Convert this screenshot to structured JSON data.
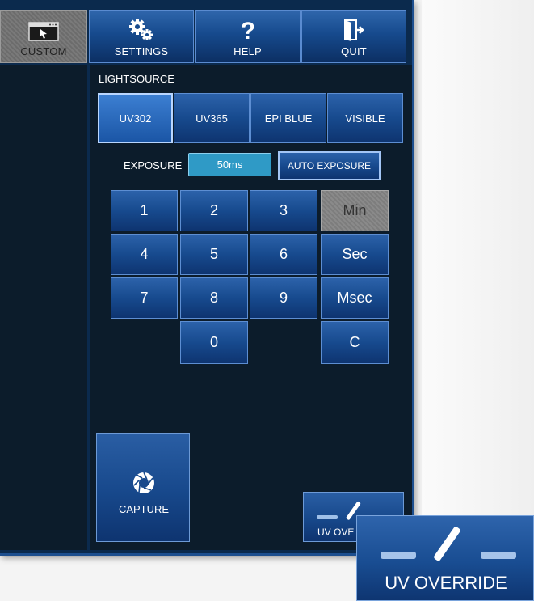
{
  "toolbar": {
    "custom_label": "CUSTOM",
    "settings_label": "SETTINGS",
    "help_label": "HELP",
    "quit_label": "QUIT"
  },
  "lightsource": {
    "label": "LIGHTSOURCE",
    "options": [
      "UV302",
      "UV365",
      "EPI BLUE",
      "VISIBLE"
    ],
    "selected": "UV302"
  },
  "exposure": {
    "label": "EXPOSURE",
    "value": "50ms",
    "auto_label": "AUTO EXPOSURE"
  },
  "keypad": {
    "digits": [
      "1",
      "2",
      "3",
      "4",
      "5",
      "6",
      "7",
      "8",
      "9",
      "0"
    ],
    "units": [
      "Min",
      "Sec",
      "Msec",
      "C"
    ],
    "selected_unit": "Min"
  },
  "capture": {
    "label": "CAPTURE"
  },
  "uv_override": {
    "small_label": "UV OVE",
    "zoom_label": "UV OVERRIDE"
  },
  "colors": {
    "panel": "#0c1c2b",
    "button": "#164a8d",
    "exposure_field": "#2f9ac6"
  },
  "icons": [
    "custom-window-icon",
    "gear-icon",
    "question-icon",
    "door-exit-icon",
    "aperture-icon",
    "uv-override-icon"
  ]
}
